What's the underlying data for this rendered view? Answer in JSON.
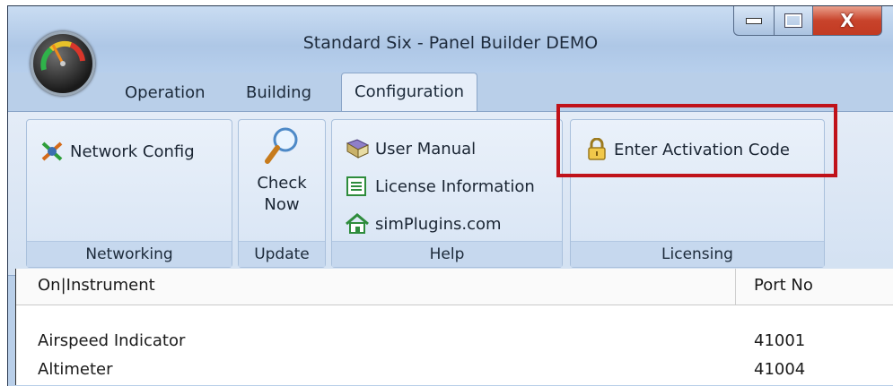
{
  "window": {
    "title": "Standard Six - Panel Builder DEMO"
  },
  "tabs": [
    {
      "label": "Operation"
    },
    {
      "label": "Building"
    },
    {
      "label": "Configuration",
      "active": true
    }
  ],
  "ribbon": {
    "networking": {
      "label": "Networking",
      "network_config": "Network Config"
    },
    "update": {
      "label": "Update",
      "check_now_line1": "Check",
      "check_now_line2": "Now"
    },
    "help": {
      "label": "Help",
      "user_manual": "User Manual",
      "license_information": "License Information",
      "website": "simPlugins.com"
    },
    "licensing": {
      "label": "Licensing",
      "enter_activation_code": "Enter Activation Code"
    }
  },
  "list": {
    "headers": {
      "instrument": "On|Instrument",
      "port": "Port No"
    },
    "rows": [
      {
        "instrument": "Airspeed Indicator",
        "port": "41001"
      },
      {
        "instrument": "Altimeter",
        "port": "41004"
      }
    ]
  },
  "colors": {
    "highlight": "#c0121a",
    "close_button": "#c8432b"
  },
  "icons": [
    "app-gauge-icon",
    "network-plug-icon",
    "magnifier-icon",
    "book-icon",
    "license-list-icon",
    "home-icon",
    "padlock-icon",
    "minimize-icon",
    "maximize-icon",
    "close-icon"
  ]
}
